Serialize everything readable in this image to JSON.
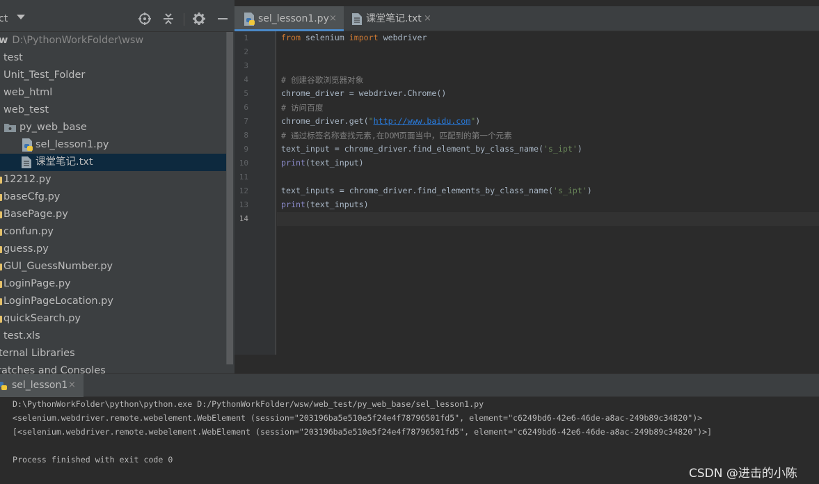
{
  "project_panel": {
    "title": "ct",
    "root": {
      "name": "w",
      "path": "D:\\PythonWorkFolder\\wsw"
    },
    "items": [
      {
        "label": "test"
      },
      {
        "label": "Unit_Test_Folder"
      },
      {
        "label": "web_html"
      },
      {
        "label": "web_test"
      },
      {
        "label": "py_web_base",
        "icon": "folder-icon"
      },
      {
        "label": "sel_lesson1.py",
        "icon": "python-file-icon"
      },
      {
        "label": "课堂笔记.txt",
        "icon": "text-file-icon",
        "selected": true
      },
      {
        "label": "12212.py"
      },
      {
        "label": "baseCfg.py"
      },
      {
        "label": "BasePage.py"
      },
      {
        "label": "confun.py"
      },
      {
        "label": "guess.py"
      },
      {
        "label": "GUI_GuessNumber.py"
      },
      {
        "label": "LoginPage.py"
      },
      {
        "label": "LoginPageLocation.py"
      },
      {
        "label": "quickSearch.py"
      },
      {
        "label": "test.xls"
      },
      {
        "label": "ternal Libraries"
      },
      {
        "label": "ratches and Consoles"
      }
    ]
  },
  "editor_tabs": [
    {
      "label": "sel_lesson1.py",
      "close": "×",
      "active": true
    },
    {
      "label": "课堂笔记.txt",
      "close": "×",
      "active": false
    }
  ],
  "editor": {
    "line_numbers": [
      "1",
      "2",
      "3",
      "4",
      "5",
      "6",
      "7",
      "8",
      "9",
      "10",
      "11",
      "12",
      "13",
      "14"
    ],
    "current_line": "14",
    "lines": {
      "l1_kw1": "from",
      "l1_mid": " selenium ",
      "l1_kw2": "import",
      "l1_end": " webdriver",
      "l4": "# 创建谷歌浏览器对象",
      "l5": "chrome_driver = webdriver.Chrome()",
      "l6": "# 访问百度",
      "l7_a": "chrome_driver.get(",
      "l7_q1": "\"",
      "l7_url": "http://www.baidu.com",
      "l7_q2": "\"",
      "l7_b": ")",
      "l8": "# 通过标签名称查找元素,在DOM页面当中，匹配到的第一个元素",
      "l9_a": "text_input = chrome_driver.find_element_by_class_name(",
      "l9_s": "'s_ipt'",
      "l9_b": ")",
      "l10_fn": "print",
      "l10_b": "(text_input)",
      "l12_a": "text_inputs = chrome_driver.find_elements_by_class_name(",
      "l12_s": "'s_ipt'",
      "l12_b": ")",
      "l13_fn": "print",
      "l13_b": "(text_inputs)"
    }
  },
  "run_panel": {
    "tab_label": "sel_lesson1",
    "tab_close": "×",
    "console": [
      "D:\\PythonWorkFolder\\python\\python.exe D:/PythonWorkFolder/wsw/web_test/py_web_base/sel_lesson1.py",
      "<selenium.webdriver.remote.webelement.WebElement (session=\"203196ba5e510e5f24e4f78796501fd5\", element=\"c6249bd6-42e6-46de-a8ac-249b89c34820\")>",
      "[<selenium.webdriver.remote.webelement.WebElement (session=\"203196ba5e510e5f24e4f78796501fd5\", element=\"c6249bd6-42e6-46de-a8ac-249b89c34820\")>]",
      "",
      "Process finished with exit code 0"
    ]
  },
  "watermark": "CSDN @进击的小陈",
  "colors": {
    "accent": "#4a88c7",
    "keyword": "#cc7832",
    "comment": "#808080",
    "string": "#6a8759",
    "selection": "#0d293e"
  }
}
